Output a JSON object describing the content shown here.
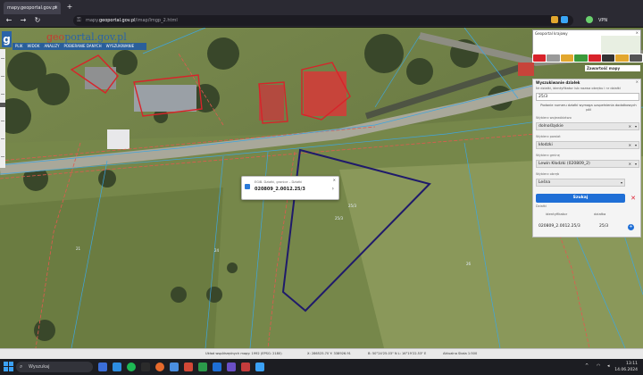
{
  "browser": {
    "tab_title": "mapy.geoportal.gov.pl",
    "new_tab_symbol": "+",
    "back_symbol": "←",
    "forward_symbol": "→",
    "reload_symbol": "↻",
    "url_prefix": "mapy.",
    "url_domain": "geoportal.gov.pl",
    "url_path": "/imap/Imgp_2.html",
    "vpn_label": "VPN"
  },
  "app": {
    "logo_letter": "g",
    "logo_brand_1": "geo",
    "logo_brand_2": "portal.gov.pl",
    "menu": [
      "PLIK",
      "WIDOK",
      "ANALIZY",
      "POBIERANIE DANYCH",
      "WYSZUKIWANIE"
    ]
  },
  "map": {
    "parcel_popup": {
      "title": "EGiB. Działki, granice – Działki",
      "parcel_id": "020809_2.0012.25/3"
    }
  },
  "minimap": {
    "title": "Geoportal krajowy",
    "close": "×"
  },
  "apps_label": "Zawartość mapy",
  "search_panel": {
    "title": "Wyszukiwanie działek",
    "close": "×",
    "subtitle": "Nr działki, identyfikator lub nazwa obrębu i nr działki",
    "query_value": "25/3",
    "note": "Podanie numeru działki wymaga uzupełnienia dodatkowych pól",
    "voivodeship_label": "Wybierz województwo",
    "voivodeship_value": "dolnośląskie",
    "county_label": "Wybierz powiat",
    "county_value": "kłodzki",
    "commune_label": "Wybierz gminę",
    "commune_value": "Lewin Kłodzki (020809_2)",
    "precinct_label": "Wybierz obręb",
    "precinct_value": "Leśna",
    "search_button": "Szukaj",
    "clear_symbol": "✕",
    "results_header": "Działki",
    "col_identifier": "identyfikator",
    "col_parcel": "działka",
    "row_identifier": "020809_2.0012.25/3",
    "row_parcel": "25/3",
    "zoom_symbol": "+"
  },
  "statusbar": {
    "system_text": "Układ współrzędnych mapy: 1992 (EPSG: 2180)",
    "xy_text": "X: 286525.70  Y: 338926.91",
    "wgs_text": "B: 50°24'25.03\" N L: 16°19'22.53\" E",
    "scale_text": "Aktualna Skala 1:500"
  },
  "taskbar": {
    "search_placeholder": "Wyszukaj",
    "time": "13:11",
    "date": "14.06.2024"
  },
  "colors": {
    "parcel_outline": "#1f1a6b",
    "building_outline": "#d8232a",
    "boundary_lines": "#e05a4f",
    "cadastral_lines": "#3ea6e0",
    "accent": "#1f6fd6"
  }
}
